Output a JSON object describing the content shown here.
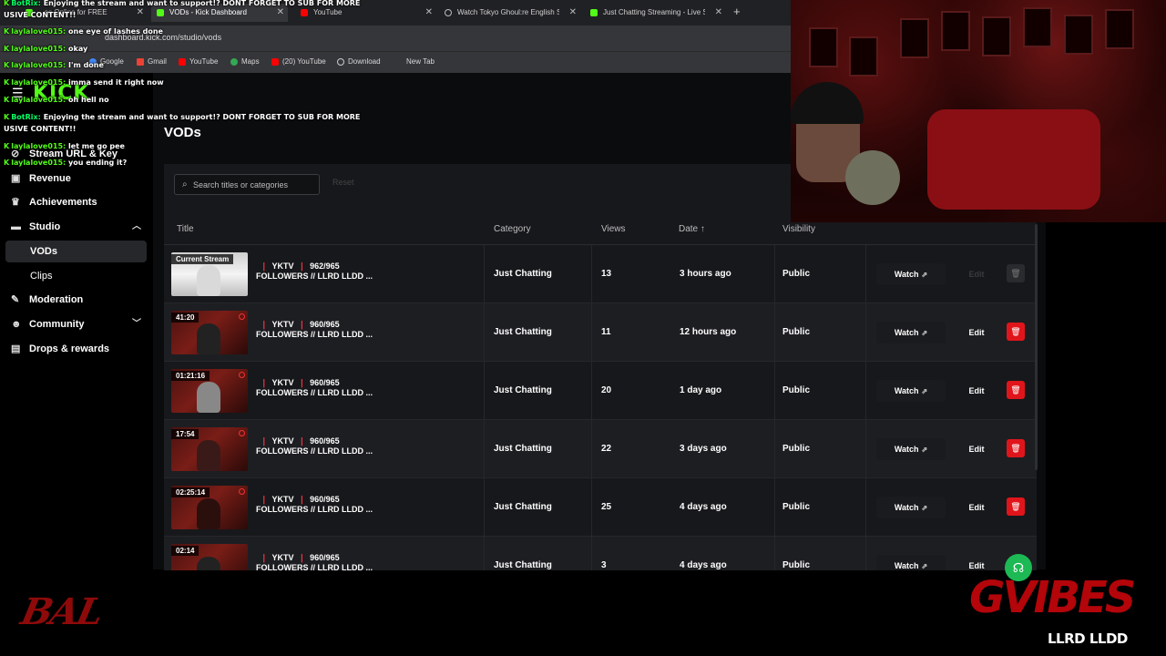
{
  "browser": {
    "tabs": [
      {
        "label": "...es Online for FREE",
        "favicon": "kick-icon"
      },
      {
        "label": "VODs - Kick Dashboard",
        "favicon": "kick-icon"
      },
      {
        "label": "YouTube",
        "favicon": "youtube-icon"
      },
      {
        "label": "Watch Tokyo Ghoul:re English S",
        "favicon": "globe-icon"
      },
      {
        "label": "Just Chatting Streaming - Live S",
        "favicon": "kick-icon"
      }
    ],
    "new_tab": "+",
    "url": "dashboard.kick.com/studio/vods",
    "bookmarks": [
      "Google",
      "Gmail",
      "YouTube",
      "Maps",
      "(20) YouTube",
      "Download",
      "New Tab"
    ]
  },
  "app": {
    "logo": "KICK",
    "page_title": "VODs",
    "nav": [
      {
        "label": "Stream URL & Key",
        "icon": "key-icon"
      },
      {
        "label": "Revenue",
        "icon": "revenue-icon"
      },
      {
        "label": "Achievements",
        "icon": "trophy-icon"
      },
      {
        "label": "Studio",
        "icon": "studio-icon"
      },
      {
        "label": "VODs"
      },
      {
        "label": "Clips"
      },
      {
        "label": "Moderation",
        "icon": "wrench-icon"
      },
      {
        "label": "Community",
        "icon": "community-icon"
      },
      {
        "label": "Drops & rewards",
        "icon": "drops-icon"
      }
    ],
    "search": {
      "placeholder": "Search titles or categories"
    },
    "reset_label": "Reset",
    "columns": {
      "title": "Title",
      "category": "Category",
      "views": "Views",
      "date": "Date ↑",
      "visibility": "Visibility"
    },
    "actions": {
      "watch": "Watch",
      "edit": "Edit"
    },
    "vods": [
      {
        "duration": "Current Stream",
        "title_line1": "YKTV",
        "title_count": "962/965",
        "title_line2": "FOLLOWERS // LLRD LLDD ...",
        "category": "Just Chatting",
        "views": "13",
        "date": "3 hours ago",
        "visibility": "Public"
      },
      {
        "duration": "41:20",
        "title_line1": "YKTV",
        "title_count": "960/965",
        "title_line2": "FOLLOWERS // LLRD LLDD ...",
        "category": "Just Chatting",
        "views": "11",
        "date": "12 hours ago",
        "visibility": "Public"
      },
      {
        "duration": "01:21:16",
        "title_line1": "YKTV",
        "title_count": "960/965",
        "title_line2": "FOLLOWERS // LLRD LLDD ...",
        "category": "Just Chatting",
        "views": "20",
        "date": "1 day ago",
        "visibility": "Public"
      },
      {
        "duration": "17:54",
        "title_line1": "YKTV",
        "title_count": "960/965",
        "title_line2": "FOLLOWERS // LLRD LLDD ...",
        "category": "Just Chatting",
        "views": "22",
        "date": "3 days ago",
        "visibility": "Public"
      },
      {
        "duration": "02:25:14",
        "title_line1": "YKTV",
        "title_count": "960/965",
        "title_line2": "FOLLOWERS // LLRD LLDD ...",
        "category": "Just Chatting",
        "views": "25",
        "date": "4 days ago",
        "visibility": "Public"
      },
      {
        "duration": "02:14",
        "title_line1": "YKTV",
        "title_count": "960/965",
        "title_line2": "FOLLOWERS // LLRD LLDD ...",
        "category": "Just Chatting",
        "views": "3",
        "date": "4 days ago",
        "visibility": "Public"
      }
    ]
  },
  "chat": [
    {
      "user": "BotRix:",
      "msg": "Enjoying the stream and want to support!? DONT FORGET TO SUB FOR MORE"
    },
    {
      "user": "",
      "msg": "USIVE CONTENT!!"
    },
    {
      "user": "laylalove015:",
      "msg": "one eye of lashes done"
    },
    {
      "user": "laylalove015:",
      "msg": "okay"
    },
    {
      "user": "laylalove015:",
      "msg": "I'm done"
    },
    {
      "user": "laylalove015:",
      "msg": "imma send it right now"
    },
    {
      "user": "laylalove015:",
      "msg": "oh hell no"
    },
    {
      "user": "BotRix:",
      "msg": "Enjoying the stream and want to support!? DONT FORGET TO SUB FOR MORE"
    },
    {
      "user": "",
      "msg": "USIVE CONTENT!!"
    },
    {
      "user": "laylalove015:",
      "msg": "let me go pee"
    },
    {
      "user": "laylalove015:",
      "msg": "you ending it?"
    }
  ],
  "overlay": {
    "left_mark": "BAL",
    "right_logo": "GVIBES",
    "caption": "LLRD LLDD"
  },
  "colors": {
    "kick_green": "#53fc18",
    "delete_red": "#e0151b",
    "panel": "#17181b"
  }
}
